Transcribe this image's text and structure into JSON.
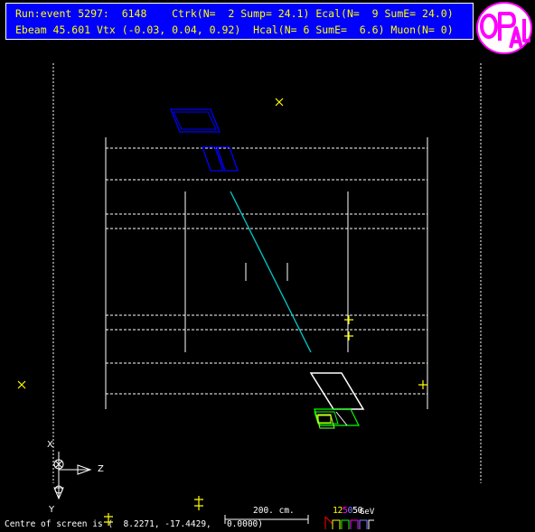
{
  "header": {
    "line1": "Run:event 5297:  6148    Ctrk(N=  2 Sump= 24.1) Ecal(N=  9 SumE= 24.0)",
    "line2": "Ebeam 45.601 Vtx (-0.03, 0.04, 0.92)  Hcal(N= 6 SumE=  6.6) Muon(N= 0)"
  },
  "logo": {
    "text": "OPAL",
    "color": "#ff00ff"
  },
  "axes": {
    "z_label": "Z",
    "x_label": "X",
    "y_label": "Y"
  },
  "footer": {
    "centre_text": "Centre of screen is (  8.2271, -17.4429,   0.0000)",
    "scale_label": "200. cm.",
    "energy_digits": [
      {
        "text": "1",
        "color": "#ffff00"
      },
      {
        "text": "2",
        "color": "#ffff00"
      },
      {
        "text": "5",
        "color": "#ff00ff"
      },
      {
        "text": "0",
        "color": "#8080ff"
      },
      {
        "text": "5",
        "color": "#ffffff"
      },
      {
        "text": "0",
        "color": "#ffffff"
      }
    ],
    "energy_unit": "GeV"
  },
  "colors": {
    "background": "#000000",
    "header_bg": "#0000ff",
    "header_text": "#ffff00",
    "track": "#00cccc",
    "muon_chamber": "#0000ff",
    "ecal": "#ffffff",
    "hcal": "#00ff00",
    "hit_marker": "#ffff00"
  }
}
